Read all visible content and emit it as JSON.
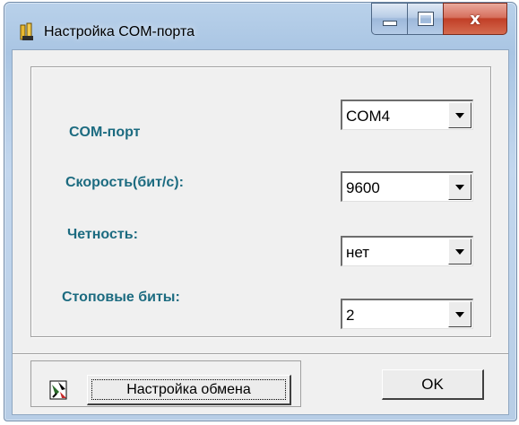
{
  "window": {
    "title": "Настройка COM-порта",
    "close_glyph": "x"
  },
  "settings": {
    "com_port": {
      "label": "COM-порт",
      "value": "COM4"
    },
    "baud_rate": {
      "label": "Скорость(бит/с):",
      "value": "9600"
    },
    "parity": {
      "label": "Четность:",
      "value": "нет"
    },
    "stop_bits": {
      "label": "Стоповые биты:",
      "value": "2"
    }
  },
  "buttons": {
    "exchange_settings": "Настройка обмена",
    "ok": "OK"
  },
  "colors": {
    "label_text": "#1c6b80",
    "close_button": "#c13f27"
  },
  "icons": {
    "app": "app-icon",
    "exchange": "exchange-settings-icon",
    "dropdown": "chevron-down-icon"
  }
}
